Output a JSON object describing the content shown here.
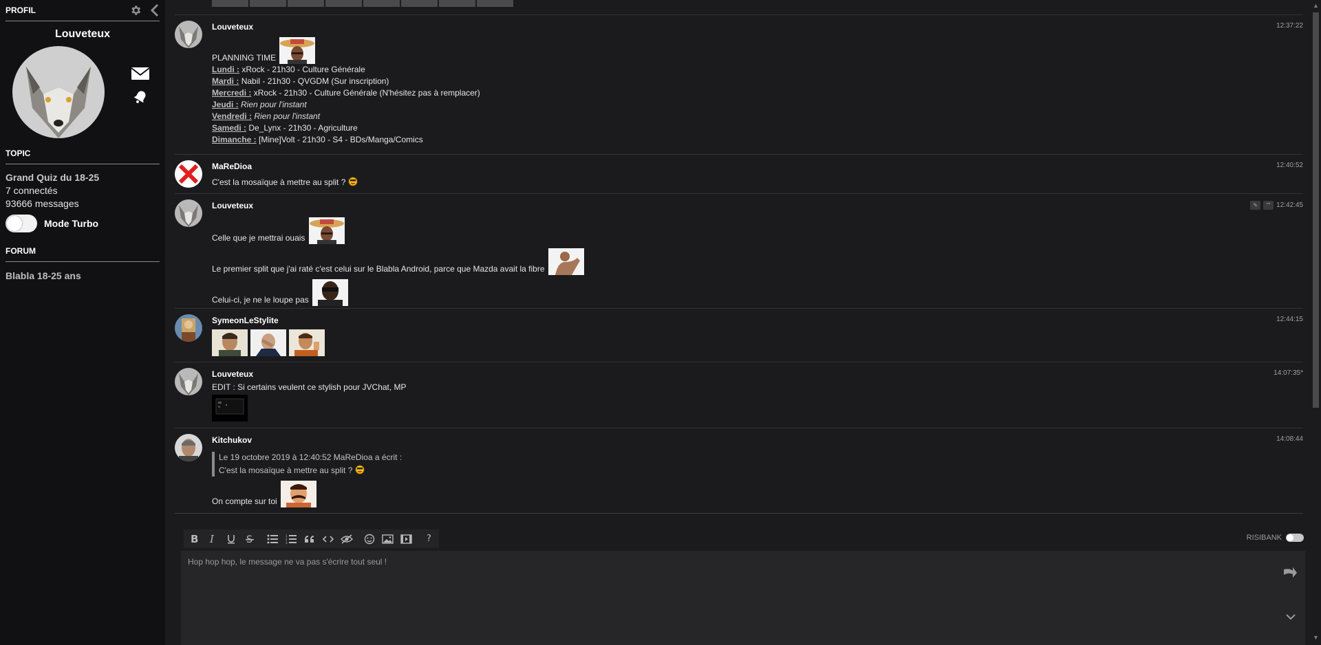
{
  "sidebar": {
    "profile_title": "PROFIL",
    "username": "Louveteux",
    "topic_title": "TOPIC",
    "topic_name": "Grand Quiz du 18-25",
    "connected": "7 connectés",
    "messages_count": "93666 messages",
    "turbo_label": "Mode Turbo",
    "forum_title": "FORUM",
    "forum_name": "Blabla 18-25 ans"
  },
  "messages": [
    {
      "author": "Louveteux",
      "time": "12:37:22",
      "header": "PLANNING TIME",
      "schedule": [
        {
          "day": "Lundi :",
          "text": "xRock - 21h30 - Culture Générale",
          "italic": false
        },
        {
          "day": "Mardi :",
          "text": "Nabil - 21h30 - QVGDM (Sur inscription)",
          "italic": false
        },
        {
          "day": "Mercredi :",
          "text": "xRock - 21h30 - Culture Générale (N'hésitez pas à remplacer)",
          "italic": false
        },
        {
          "day": "Jeudi :",
          "text": "Rien pour l'instant",
          "italic": true
        },
        {
          "day": "Vendredi :",
          "text": "Rien pour l'instant",
          "italic": true
        },
        {
          "day": "Samedi :",
          "text": "De_Lynx - 21h30 - Agriculture",
          "italic": false
        },
        {
          "day": "Dimanche :",
          "text": "[Mine]Volt - 21h30 - S4 - BDs/Manga/Comics",
          "italic": false
        }
      ]
    },
    {
      "author": "MaReDioa",
      "time": "12:40:52",
      "text": "C'est la mosaïque à mettre au split ?"
    },
    {
      "author": "Louveteux",
      "time": "12:42:45",
      "lines": [
        "Celle que je mettrai ouais",
        "Le premier split que j'ai raté c'est celui sur le Blabla Android, parce que Mazda avait la fibre",
        "Celui-ci, je ne le loupe pas"
      ],
      "quote_btn": "\"\""
    },
    {
      "author": "SymeonLeStylite",
      "time": "12:44:15"
    },
    {
      "author": "Louveteux",
      "time": "14:07:35*",
      "text": "EDIT : Si certains veulent ce stylish pour JVChat, MP"
    },
    {
      "author": "Kitchukov",
      "time": "14:08:44",
      "quote_header": "Le 19 octobre 2019 à 12:40:52 MaReDioa a écrit :",
      "quote_text": "C'est la mosaïque à mettre au split ?",
      "text": "On compte sur toi"
    }
  ],
  "editor": {
    "placeholder": "Hop hop hop, le message ne va pas s'écrire tout seul !",
    "risibank_label": "RISIBANK",
    "help_label": "?"
  }
}
